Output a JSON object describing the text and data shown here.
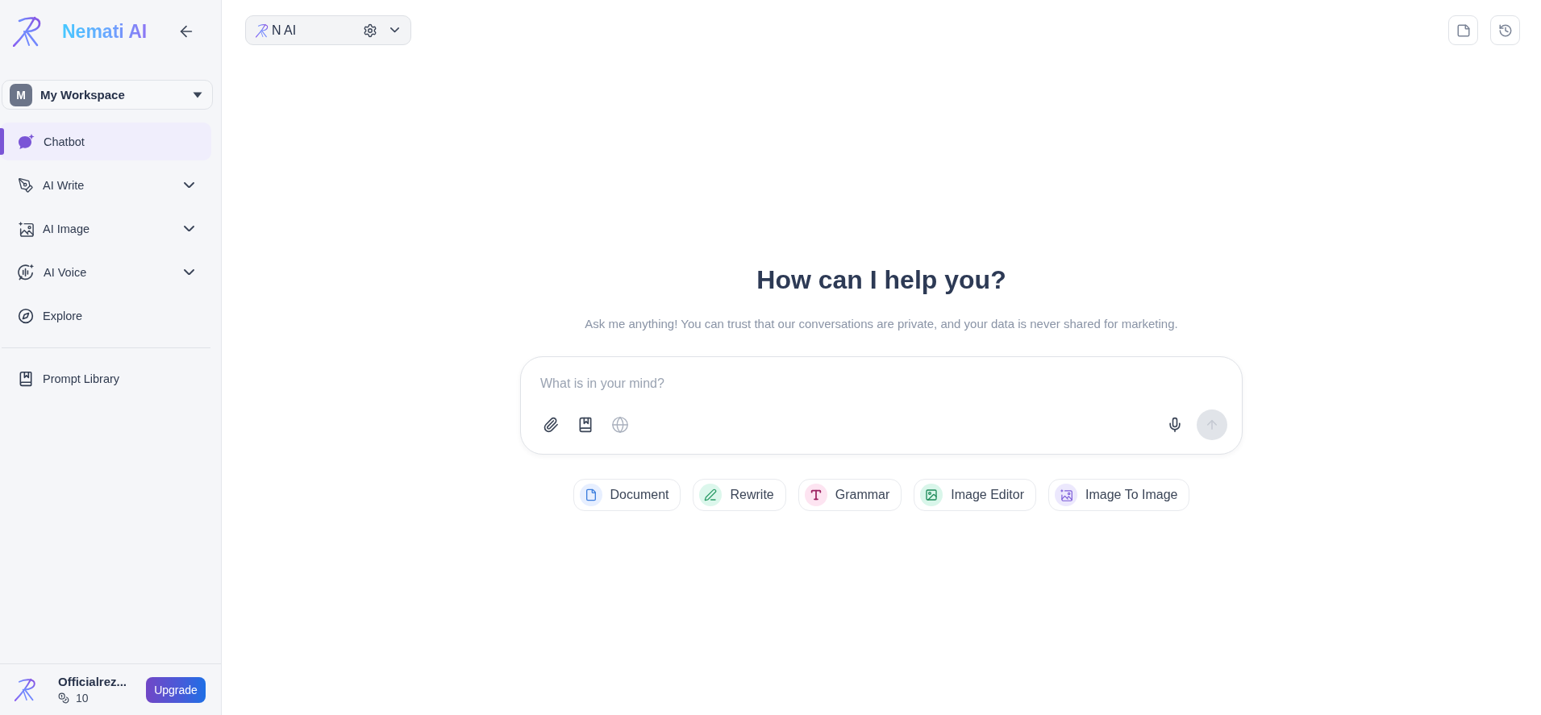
{
  "sidebar": {
    "brand": "Nemati AI",
    "workspace": {
      "initial": "M",
      "name": "My Workspace"
    },
    "nav": [
      {
        "label": "Chatbot",
        "kind": "link",
        "selected": true
      },
      {
        "label": "AI Write",
        "kind": "group",
        "selected": false
      },
      {
        "label": "AI Image",
        "kind": "group",
        "selected": false
      },
      {
        "label": "AI Voice",
        "kind": "group",
        "selected": false
      },
      {
        "label": "Explore",
        "kind": "link",
        "selected": false
      }
    ],
    "library": [
      {
        "label": "Prompt Library",
        "selected": false
      }
    ],
    "account": {
      "name": "Officialrez...",
      "credits": "10",
      "upgrade": "Upgrade"
    }
  },
  "topbar": {
    "model": "N AI"
  },
  "main": {
    "heading": "How can I help you?",
    "subtitle": "Ask me anything! You can trust that our conversations are private, and your data is never shared for marketing.",
    "composer": {
      "placeholder": "What is in your mind?",
      "send_disabled": true
    },
    "shortcuts": [
      {
        "label": "Document",
        "kind": "document"
      },
      {
        "label": "Rewrite",
        "kind": "rewrite"
      },
      {
        "label": "Grammar",
        "kind": "grammar"
      },
      {
        "label": "Image Editor",
        "kind": "image_editor"
      },
      {
        "label": "Image To Image",
        "kind": "image_to_image"
      }
    ]
  }
}
